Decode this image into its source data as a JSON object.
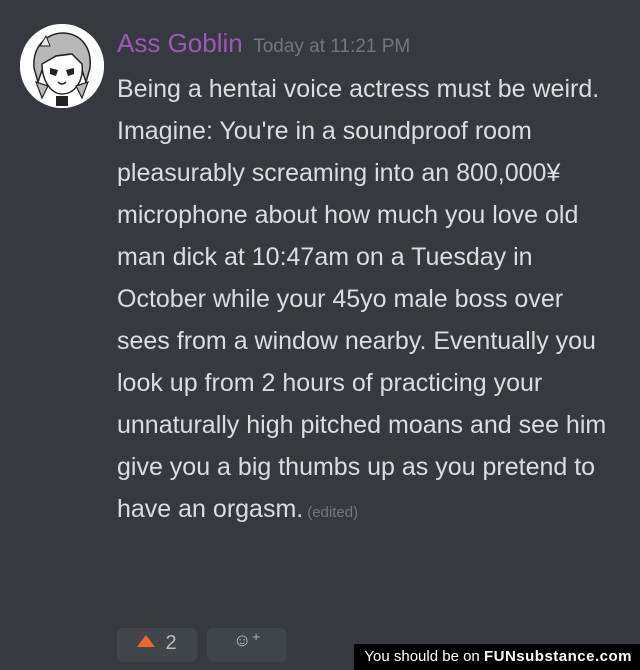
{
  "message": {
    "username": "Ass Goblin",
    "timestamp": "Today at 11:21 PM",
    "text": "Being a hentai voice actress must be weird. Imagine: You're in a soundproof room pleasurably screaming into an 800,000¥ microphone about how much you love old man dick at 10:47am on a Tuesday in October while your 45yo male boss over sees from a window nearby. Eventually you look up from 2 hours of practicing your unnaturally high pitched moans and see him give you a big thumbs up as you pretend to have an orgasm.",
    "edited_label": "(edited)",
    "avatar_icon": "anime-girl-avatar"
  },
  "reactions": [
    {
      "icon": "upvote-arrow-icon",
      "count": "2"
    }
  ],
  "add_reaction": {
    "icon": "add-reaction-icon",
    "label": "☺⁺"
  },
  "watermark": {
    "prefix": "You should be on",
    "brand": "FUNsubstance.com"
  },
  "colors": {
    "background": "#36393f",
    "username": "#9b59b6",
    "text": "#dcddde",
    "muted": "#72767d"
  }
}
